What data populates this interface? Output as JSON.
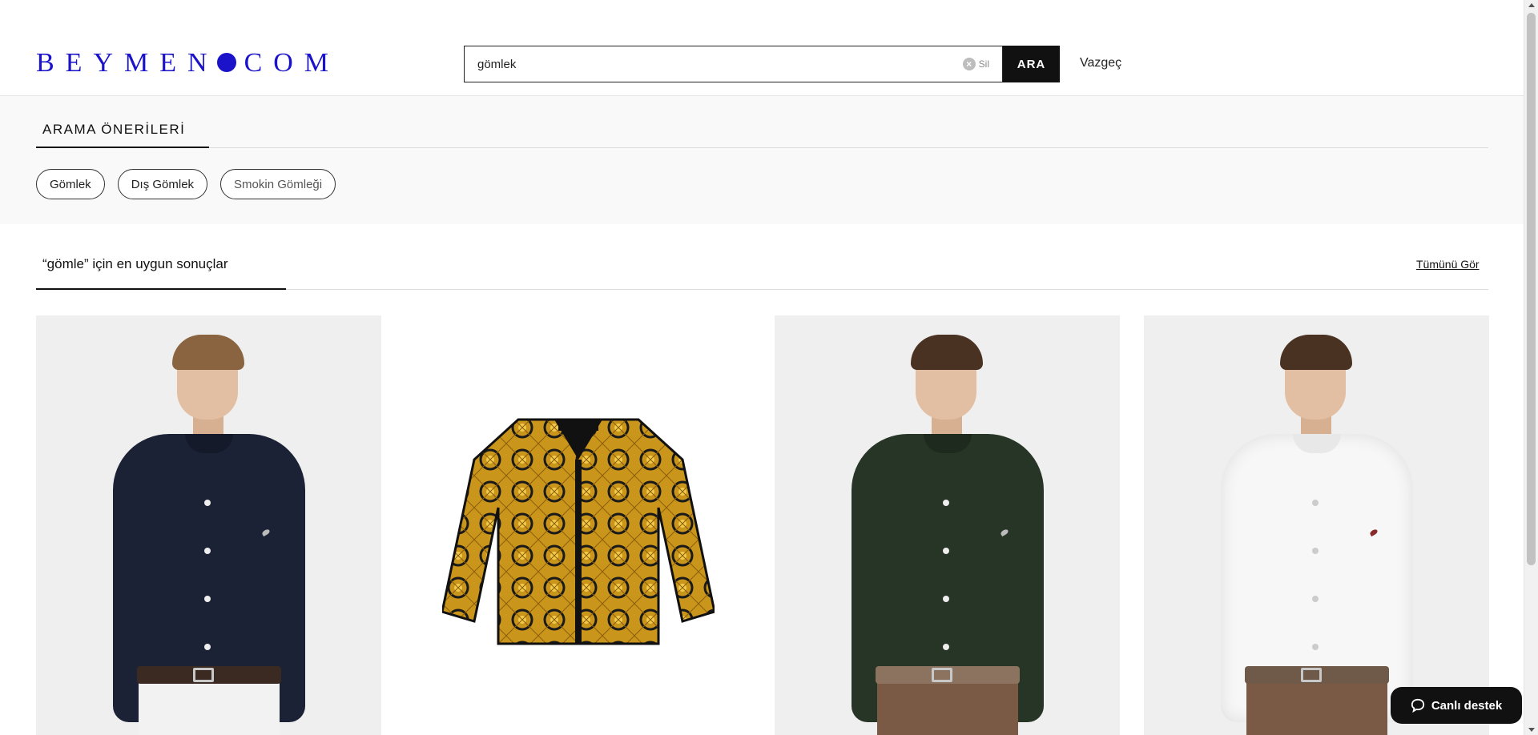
{
  "header": {
    "logo_text": "BEYMEN.COM",
    "search": {
      "value": "gömlek",
      "clear_label": "Sil",
      "button_label": "ARA"
    },
    "cancel_label": "Vazgeç"
  },
  "suggestions": {
    "title": "ARAMA ÖNERİLERİ",
    "chips": [
      {
        "label": "Gömlek"
      },
      {
        "label": "Dış Gömlek"
      },
      {
        "label": "Smokin Gömleği"
      }
    ]
  },
  "results": {
    "title": "“gömle” için en uygun sonuçlar",
    "see_all_label": "Tümünü Gör",
    "products": [
      {
        "image": "navy-shirt-model",
        "shirt_color": "#1c2235",
        "pants_color": "#f2f2f2",
        "belt_color": "#3a2a22"
      },
      {
        "image": "versace-baroque-silk-shirt",
        "colors": [
          "#d4a017",
          "#1a1a1a"
        ]
      },
      {
        "image": "green-shirt-model",
        "shirt_color": "#263526",
        "pants_color": "#7a5a44",
        "belt_color": "#8b7360"
      },
      {
        "image": "white-shirt-model",
        "shirt_color": "#f7f7f7",
        "pants_color": "#7a5a44",
        "belt_color": "#6f5a4a"
      }
    ]
  },
  "chat": {
    "label": "Canlı destek"
  }
}
